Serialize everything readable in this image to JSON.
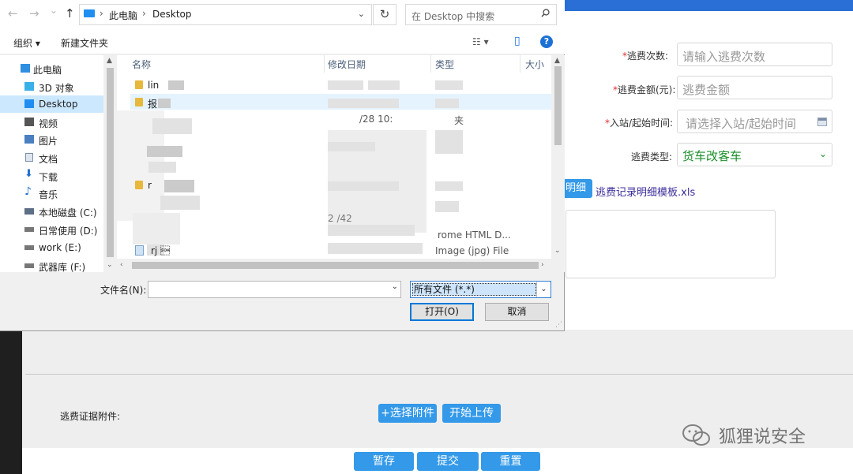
{
  "dialog": {
    "nav_back": "←",
    "nav_forward": "→",
    "nav_recent": "⌄",
    "nav_up": "↑",
    "breadcrumb": [
      "此电脑",
      "Desktop"
    ],
    "breadcrumb_sep": "›",
    "refresh": "↻",
    "search_placeholder": "在 Desktop 中搜索",
    "toolbar": {
      "organize": "组织 ▾",
      "new_folder": "新建文件夹",
      "view": "☷ ▾",
      "preview": "▯",
      "help": "?"
    },
    "nav_items": [
      {
        "label": "此电脑",
        "icon": "computer-icon",
        "color": "#2f8fe0"
      },
      {
        "label": "3D 对象",
        "icon": "cube-icon",
        "color": "#3ab0e8"
      },
      {
        "label": "Desktop",
        "icon": "desktop-icon",
        "color": "#1f8ef0",
        "selected": true
      },
      {
        "label": "视频",
        "icon": "video-icon",
        "color": "#555555"
      },
      {
        "label": "图片",
        "icon": "picture-icon",
        "color": "#4a7fc0"
      },
      {
        "label": "文档",
        "icon": "document-icon",
        "color": "#7a8ea8"
      },
      {
        "label": "下载",
        "icon": "download-icon",
        "color": "#1f6fd0"
      },
      {
        "label": "音乐",
        "icon": "music-icon",
        "color": "#1f6fd0"
      },
      {
        "label": "本地磁盘 (C:)",
        "icon": "drive-icon",
        "color": "#5c6f86"
      },
      {
        "label": "日常使用 (D:)",
        "icon": "drive-icon",
        "color": "#777777"
      },
      {
        "label": "work (E:)",
        "icon": "drive-icon",
        "color": "#777777"
      },
      {
        "label": "武器库 (F:)",
        "icon": "drive-icon",
        "color": "#777777"
      }
    ],
    "columns": {
      "name": "名称",
      "modified": "修改日期",
      "type": "类型",
      "size": "大小"
    },
    "files": [
      {
        "name": "lin",
        "modified": "",
        "type": "",
        "icon": "folder-icon"
      },
      {
        "name": "报",
        "modified": "",
        "type": "",
        "icon": "folder-icon"
      },
      {
        "name": "",
        "modified": "/28 10:",
        "type": "夹",
        "icon": ""
      },
      {
        "name": "",
        "modified": "",
        "type": "",
        "icon": ""
      },
      {
        "name": "",
        "modified": "",
        "type": "",
        "icon": ""
      },
      {
        "name": "",
        "modified": "",
        "type": "",
        "icon": ""
      },
      {
        "name": "r",
        "modified": "",
        "type": "",
        "icon": "folder-icon"
      },
      {
        "name": "",
        "modified": "",
        "type": "",
        "icon": ""
      },
      {
        "name": "",
        "modified": "2    /42",
        "type": "",
        "icon": ""
      },
      {
        "name": "",
        "modified": "",
        "type": "rome HTML D...",
        "icon": ""
      },
      {
        "name": "rj \u0001",
        "modified": "",
        "type": "Image (jpg) File",
        "icon": "image-icon"
      }
    ],
    "filename_label": "文件名(N):",
    "filename_value": "",
    "filetype_value": "所有文件 (*.*)",
    "open_button": "打开(O)",
    "cancel_button": "取消"
  },
  "form": {
    "count_label": "逃费次数:",
    "count_placeholder": "请输入逃费次数",
    "amount_label": "逃费金额(元):",
    "amount_placeholder": "逃费金额",
    "time_label": "入站/起始时间:",
    "time_placeholder": "请选择入站/起始时间",
    "type_label": "逃费类型:",
    "type_value": "货车改客车",
    "detail_button_partial": "明细",
    "template_link": "逃费记录明细模板.xls",
    "attach_label": "逃费证据附件:",
    "choose_attach_button": "+选择附件",
    "upload_button": "开始上传",
    "save_button": "暂存",
    "submit_button": "提交",
    "reset_button": "重置",
    "required_mark": "*"
  },
  "watermark": {
    "text": "狐狸说安全"
  },
  "colors": {
    "accent_blue": "#3399e8",
    "select_green": "#1a8f2a",
    "topbar_blue": "#2a6fd6",
    "link_purple": "#3a2d9a"
  }
}
